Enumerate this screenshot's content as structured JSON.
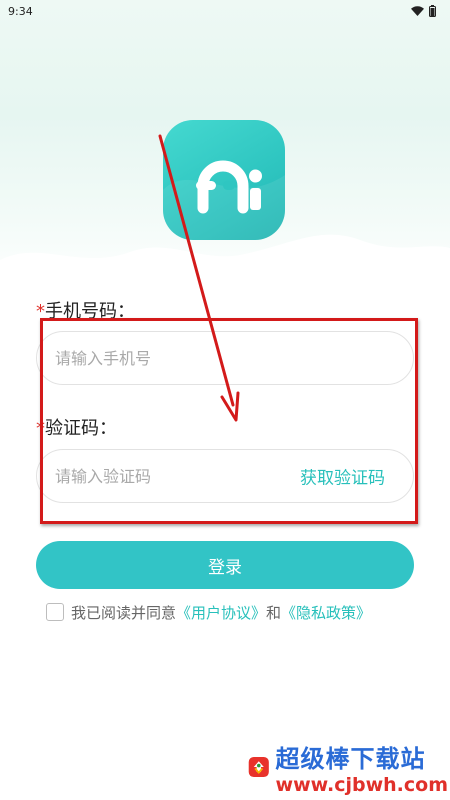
{
  "status_bar": {
    "time": "9:34"
  },
  "colors": {
    "accent": "#32c4c6",
    "link": "#28c0bb",
    "required": "#e0302a",
    "annotation": "#d31a1a"
  },
  "phone": {
    "label": "手机号码：",
    "required_mark": "*",
    "placeholder": "请输入手机号"
  },
  "code": {
    "label": "验证码：",
    "required_mark": "*",
    "placeholder": "请输入验证码",
    "get_code_label": "获取验证码"
  },
  "login": {
    "label": "登录"
  },
  "agreement": {
    "prefix": "我已阅读并同意",
    "user_agreement": "《用户协议》",
    "and": "和",
    "privacy_policy": "《隐私政策》",
    "checked": false
  },
  "watermark": {
    "title": "超级棒下载站",
    "url": "www.cjbwh.com"
  }
}
